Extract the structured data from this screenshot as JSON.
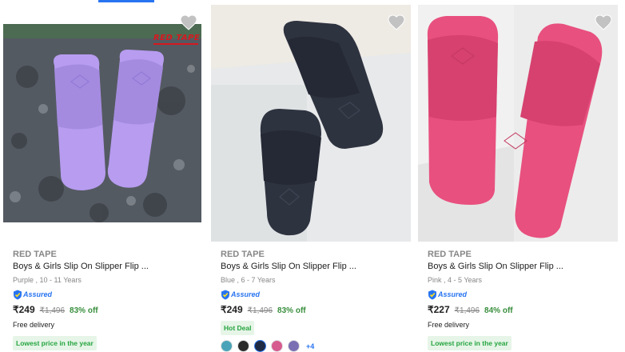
{
  "products": [
    {
      "brand": "RED TAPE",
      "title": "Boys & Girls Slip On Slipper Flip ...",
      "variant": "Purple , 10 - 11 Years",
      "assured": "Assured",
      "price": "₹249",
      "mrp": "₹1,496",
      "off": "83% off",
      "delivery": "Free delivery",
      "tag": "Lowest price in the year",
      "logo": "RED TAPE",
      "image_color": "#b79cf0"
    },
    {
      "brand": "RED TAPE",
      "title": "Boys & Girls Slip On Slipper Flip ...",
      "variant": "Blue , 6 - 7 Years",
      "assured": "Assured",
      "price": "₹249",
      "mrp": "₹1,496",
      "off": "83% off",
      "delivery": "",
      "tag": "Hot Deal",
      "more_colors": "+4",
      "swatches": [
        "#4aa3b8",
        "#2b2b2b",
        "#1f2a44",
        "#d65b8f",
        "#7a6fb3"
      ],
      "image_color": "#2e3340"
    },
    {
      "brand": "RED TAPE",
      "title": "Boys & Girls Slip On Slipper Flip ...",
      "variant": "Pink , 4 - 5 Years",
      "assured": "Assured",
      "price": "₹227",
      "mrp": "₹1,496",
      "off": "84% off",
      "delivery": "Free delivery",
      "tag": "Lowest price in the year",
      "image_color": "#e8507f"
    }
  ],
  "icons": {
    "wishlist": "heart-icon",
    "assured": "assured-shield-icon"
  },
  "colors": {
    "accent": "#2874f0",
    "offer_green": "#388e3c",
    "tag_bg": "#e6f5e7"
  }
}
